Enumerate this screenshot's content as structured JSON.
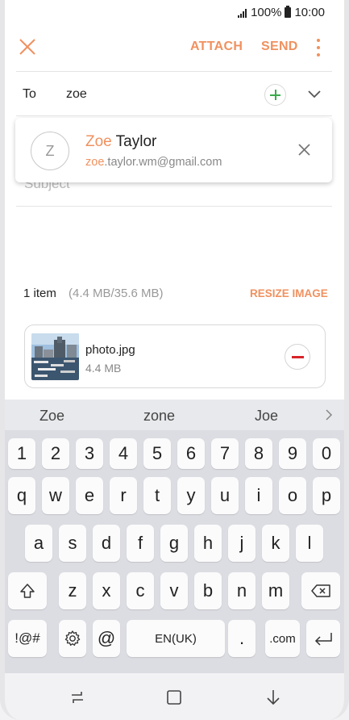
{
  "status_bar": {
    "battery_percent": "100%",
    "time": "10:00"
  },
  "toolbar": {
    "attach_label": "ATTACH",
    "send_label": "SEND"
  },
  "compose": {
    "to_label": "To",
    "to_value": "zoe",
    "subject_placeholder": "Subject"
  },
  "suggestion": {
    "avatar_letter": "Z",
    "name_match": "Zoe",
    "name_rest": " Taylor",
    "email_match": "zoe",
    "email_rest": ".taylor.wm@gmail.com"
  },
  "attachments": {
    "count_label": "1 item",
    "size_label": "(4.4 MB/35.6 MB)",
    "resize_label": "RESIZE IMAGE",
    "files": [
      {
        "name": "photo.jpg",
        "size": "4.4 MB"
      }
    ]
  },
  "keyboard": {
    "predictions": [
      "Zoe",
      "zone",
      "Joe"
    ],
    "row_numbers": [
      "1",
      "2",
      "3",
      "4",
      "5",
      "6",
      "7",
      "8",
      "9",
      "0"
    ],
    "row_top": [
      "q",
      "w",
      "e",
      "r",
      "t",
      "y",
      "u",
      "i",
      "o",
      "p"
    ],
    "row_middle": [
      "a",
      "s",
      "d",
      "f",
      "g",
      "h",
      "j",
      "k",
      "l"
    ],
    "row_bottom": [
      "z",
      "x",
      "c",
      "v",
      "b",
      "n",
      "m"
    ],
    "symbols_label": "!@#",
    "at_label": "@",
    "space_label": "EN(UK)",
    "period_label": ".",
    "dotcom_label": ".com"
  },
  "colors": {
    "accent": "#f0915f",
    "add_green": "#3aaa4c",
    "remove_red": "#d8242a"
  }
}
